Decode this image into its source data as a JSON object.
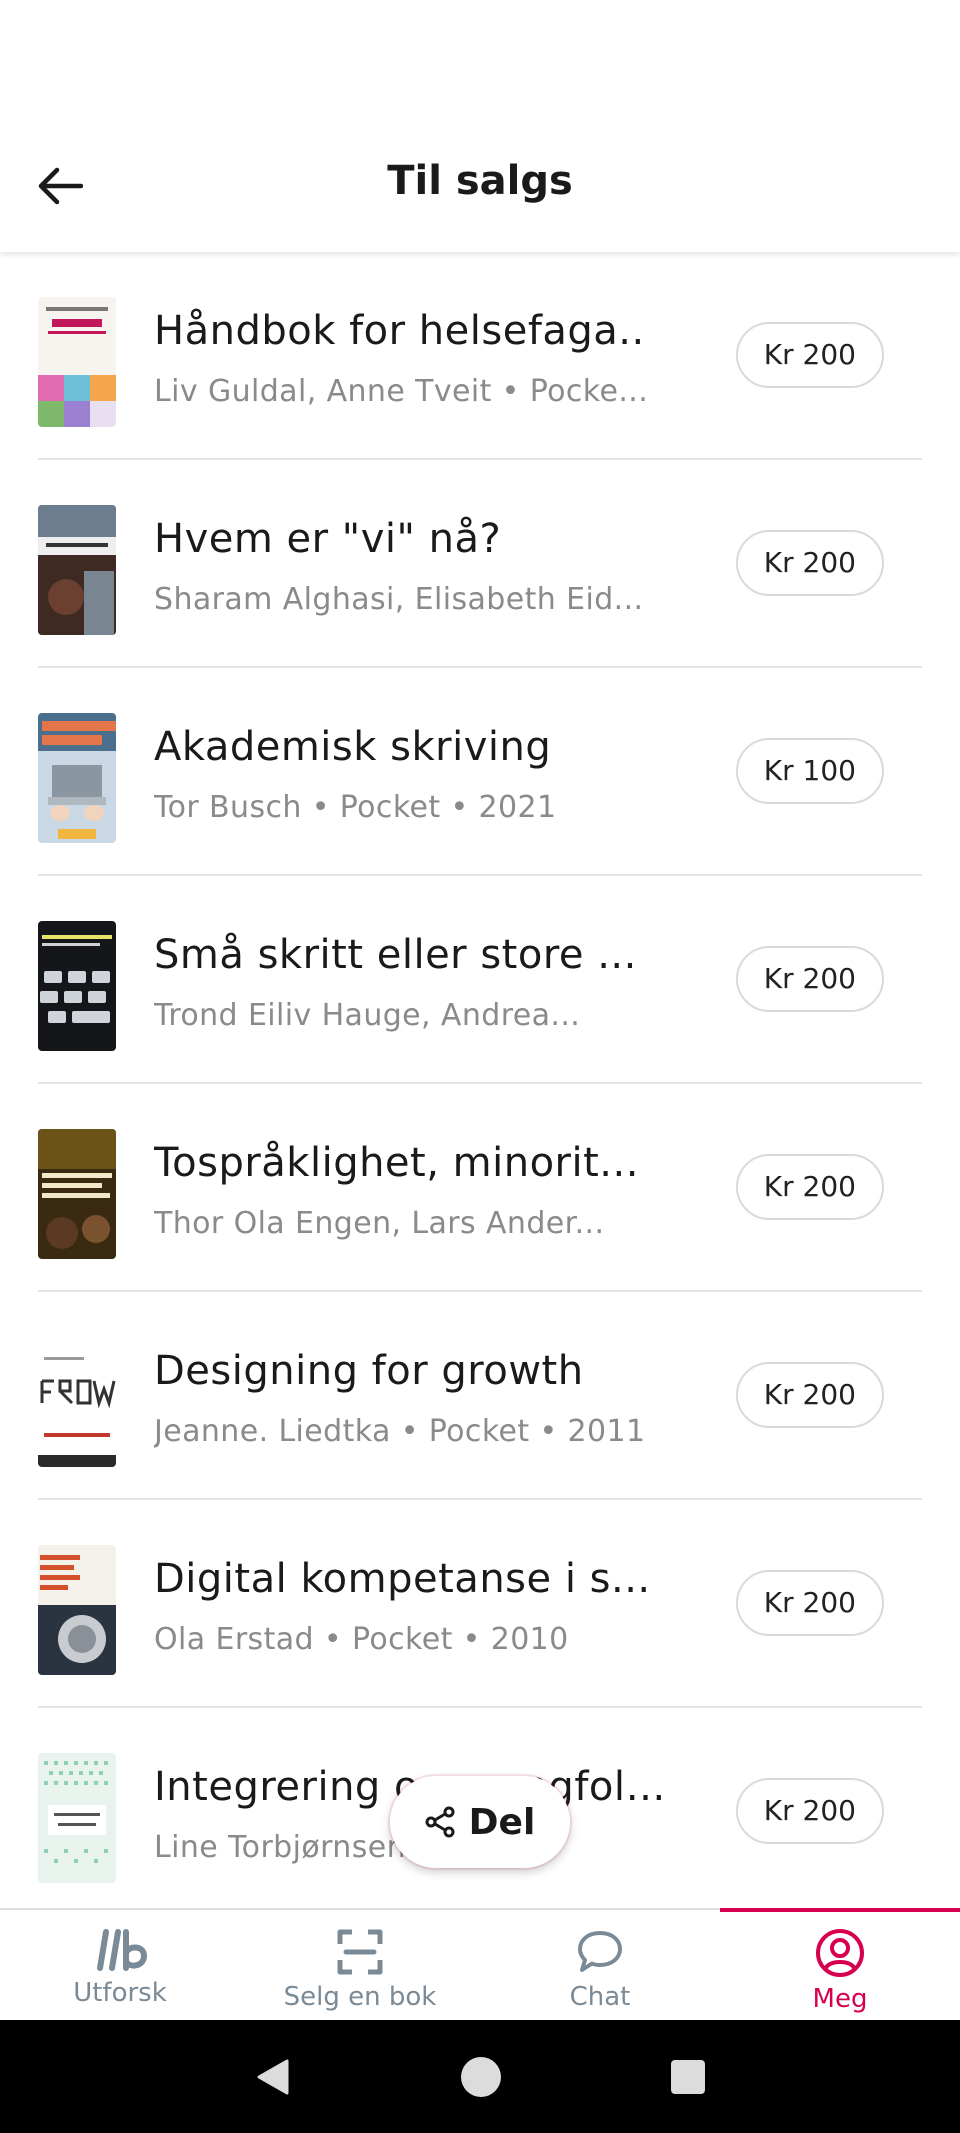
{
  "header": {
    "title": "Til salgs"
  },
  "items": [
    {
      "title": "Håndbok for helsefaga..",
      "meta": "Liv Guldal, Anne Tveit • Pocke...",
      "price": "Kr 200"
    },
    {
      "title": "Hvem er \"vi\" nå?",
      "meta": "Sharam Alghasi, Elisabeth Eid...",
      "price": "Kr 200"
    },
    {
      "title": "Akademisk skriving",
      "meta": "Tor Busch • Pocket • 2021",
      "price": "Kr 100"
    },
    {
      "title": "Små skritt eller store ...",
      "meta": "Trond Eiliv Hauge, Andrea...",
      "price": "Kr 200"
    },
    {
      "title": "Tospråklighet, minorit...",
      "meta": "Thor Ola Engen, Lars Ander...",
      "price": "Kr 200"
    },
    {
      "title": "Designing for growth",
      "meta": "Jeanne. Liedtka • Pocket • 2011",
      "price": "Kr 200"
    },
    {
      "title": "Digital kompetanse i s...",
      "meta": "Ola Erstad • Pocket • 2010",
      "price": "Kr 200"
    },
    {
      "title": "Integrering og mangfoldsmi...",
      "meta": "Line Torbjørnsen",
      "price": "Kr 200"
    }
  ],
  "share": {
    "label": "Del",
    "icon": "share-icon"
  },
  "nav": [
    {
      "label": "Utforsk",
      "icon": "explore-logo-icon"
    },
    {
      "label": "Selg en bok",
      "icon": "scan-frame-icon"
    },
    {
      "label": "Chat",
      "icon": "chat-bubble-icon"
    },
    {
      "label": "Meg",
      "icon": "profile-icon",
      "active": true
    }
  ],
  "colors": {
    "accent": "#d6004f",
    "inactive": "#7a8a96",
    "divider": "#e2e2e2"
  }
}
